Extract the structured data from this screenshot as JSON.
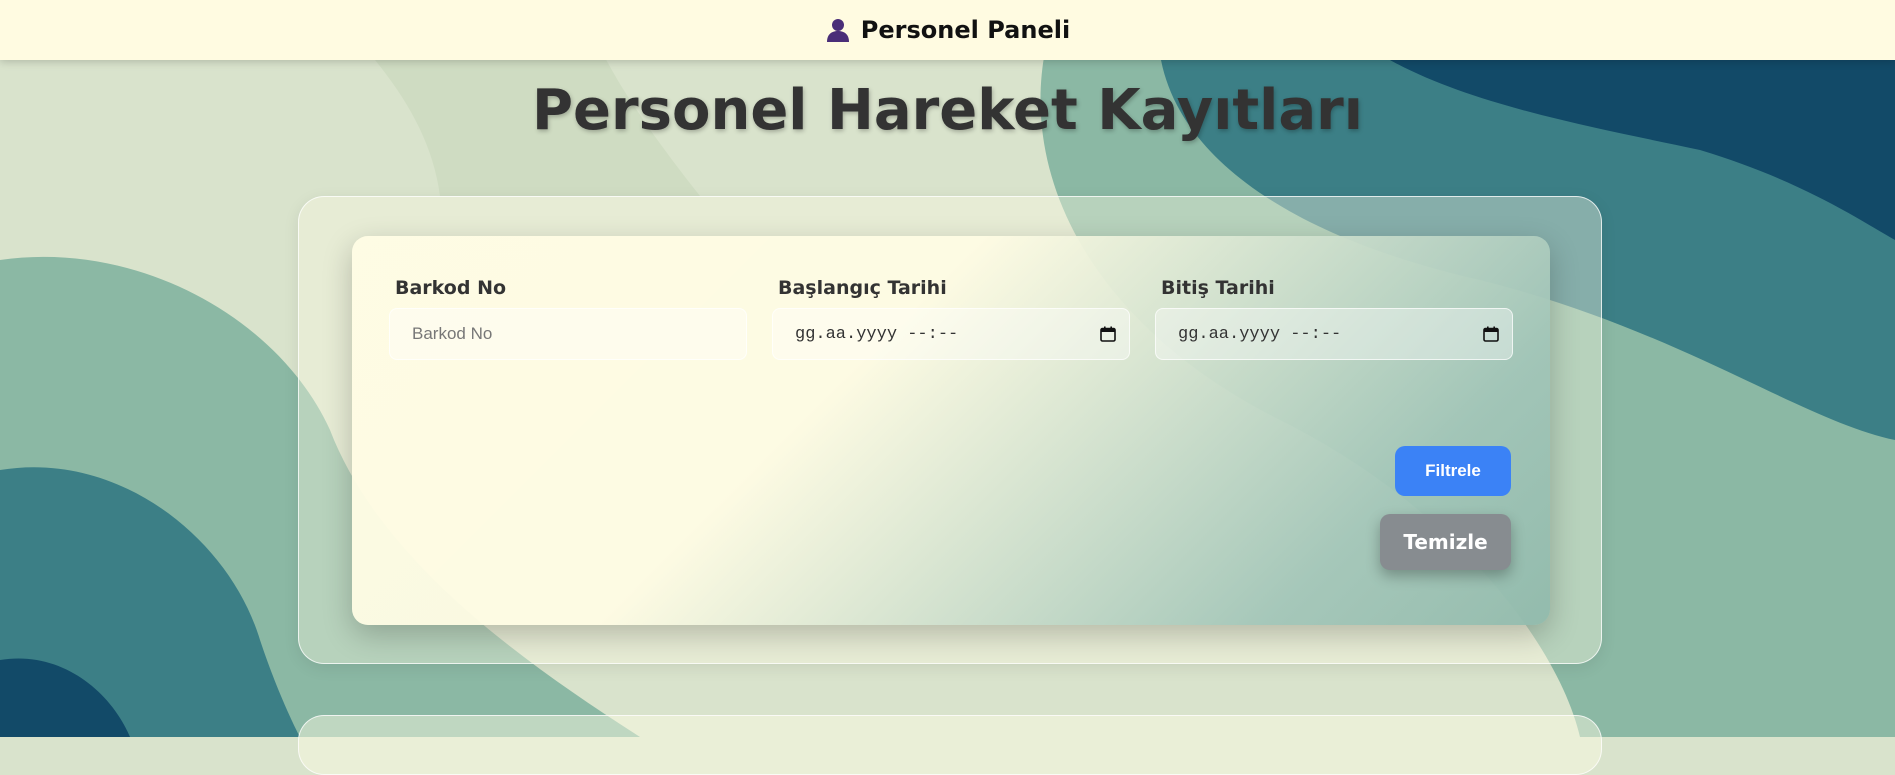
{
  "topbar": {
    "icon": "user-icon",
    "title": "Personel Paneli"
  },
  "page": {
    "title": "Personel Hareket Kayıtları"
  },
  "filter": {
    "barcode": {
      "label": "Barkod No",
      "placeholder": "Barkod No",
      "value": ""
    },
    "start_date": {
      "label": "Başlangıç Tarihi",
      "value": "gg.aa.yyyy --:--",
      "icon": "calendar-icon"
    },
    "end_date": {
      "label": "Bitiş Tarihi",
      "value": "gg.aa.yyyy --:--",
      "icon": "calendar-icon"
    },
    "filter_button": "Filtrele",
    "clear_button": "Temizle"
  },
  "colors": {
    "topbar_bg": "#fffbe1",
    "filter_button": "#3b82f6",
    "clear_button": "#878c90",
    "background_light": "#d9e3cc",
    "background_teal": "#3c7f86",
    "background_dark": "#124a68"
  }
}
